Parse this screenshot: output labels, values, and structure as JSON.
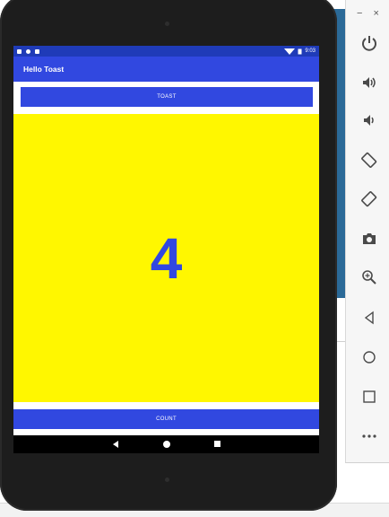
{
  "app": {
    "title": "Hello Toast",
    "count": "4",
    "toast_button_label": "TOAST",
    "count_button_label": "COUNT"
  },
  "statusbar": {
    "time": "9:03"
  },
  "window_controls": {
    "minimize": "−",
    "close": "×"
  },
  "toolbar": {
    "items": [
      "power-icon",
      "volume-up-icon",
      "volume-down-icon",
      "rotate-left-icon",
      "rotate-right-icon",
      "camera-icon",
      "zoom-icon",
      "back-icon",
      "home-icon",
      "overview-icon",
      "more-icon"
    ]
  },
  "colors": {
    "primary": "#3148e0",
    "status_bar": "#1f3bb8",
    "count_background": "#fff700"
  }
}
